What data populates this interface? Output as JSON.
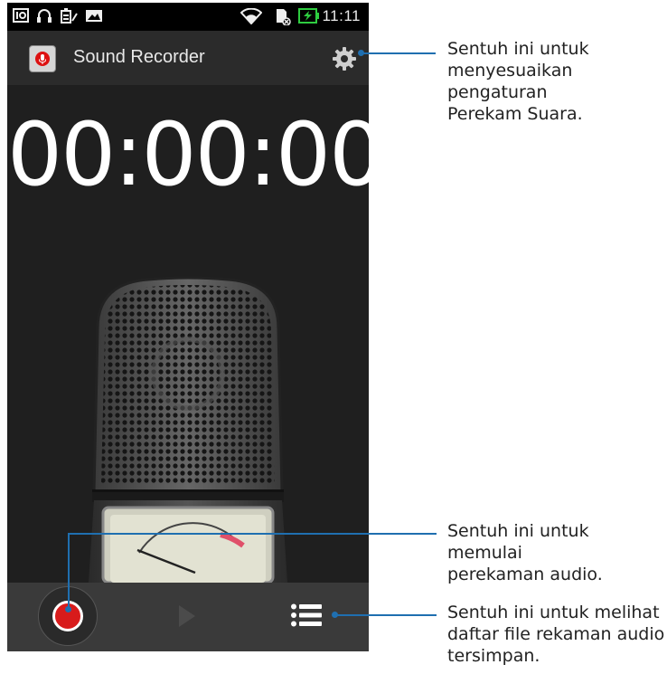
{
  "status_bar": {
    "time": "11:11",
    "icons": [
      "notification-icon",
      "headset-icon",
      "battery-saver-icon",
      "image-icon",
      "wifi-icon",
      "sd-card-icon",
      "charging-battery-icon"
    ]
  },
  "app_bar": {
    "title": "Sound Recorder",
    "app_icon": "microphone-icon",
    "settings_icon": "gear-icon"
  },
  "timer": {
    "value": "00:00:00"
  },
  "controls": {
    "record_icon": "record-icon",
    "play_icon": "play-icon",
    "list_icon": "list-icon"
  },
  "callouts": {
    "settings": [
      "Sentuh ini untuk",
      "menyesuaikan pengaturan",
      "Perekam Suara."
    ],
    "record": [
      "Sentuh ini untuk memulai",
      "perekaman audio."
    ],
    "list": [
      "Sentuh ini untuk melihat",
      "daftar file rekaman audio",
      "tersimpan."
    ]
  },
  "colors": {
    "record_red": "#d81b1b",
    "callout_blue": "#1f6fb0",
    "background": "#1f1f1f"
  }
}
